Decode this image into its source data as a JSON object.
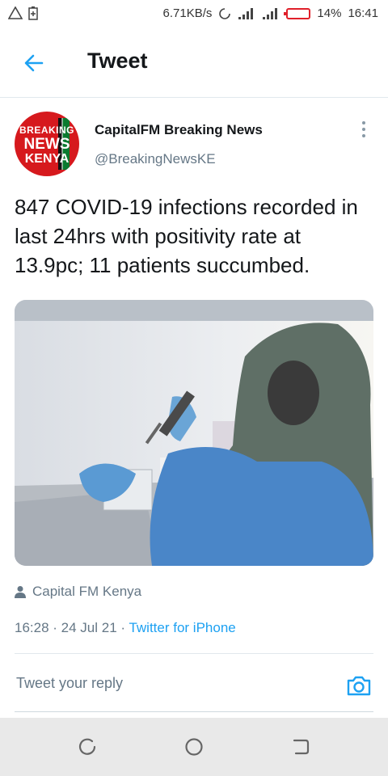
{
  "status_bar": {
    "speed": "6.71KB/s",
    "battery": "14%",
    "time": "16:41"
  },
  "header": {
    "title": "Tweet"
  },
  "tweet": {
    "author_name": "CapitalFM Breaking News",
    "handle": "@BreakingNewsKE",
    "avatar_text": [
      "BREAKING",
      "NEWS",
      "KENYA"
    ],
    "text": "847 COVID-19 infections recorded in last 24hrs with positivity rate at 13.9pc; 11 patients succumbed.",
    "media_source": "Capital FM Kenya",
    "time": "16:28 · 24 Jul 21 · ",
    "client": "Twitter for iPhone"
  },
  "reply": {
    "placeholder": "Tweet your reply"
  },
  "colors": {
    "accent": "#1da1f2",
    "secondary_text": "#657786"
  }
}
